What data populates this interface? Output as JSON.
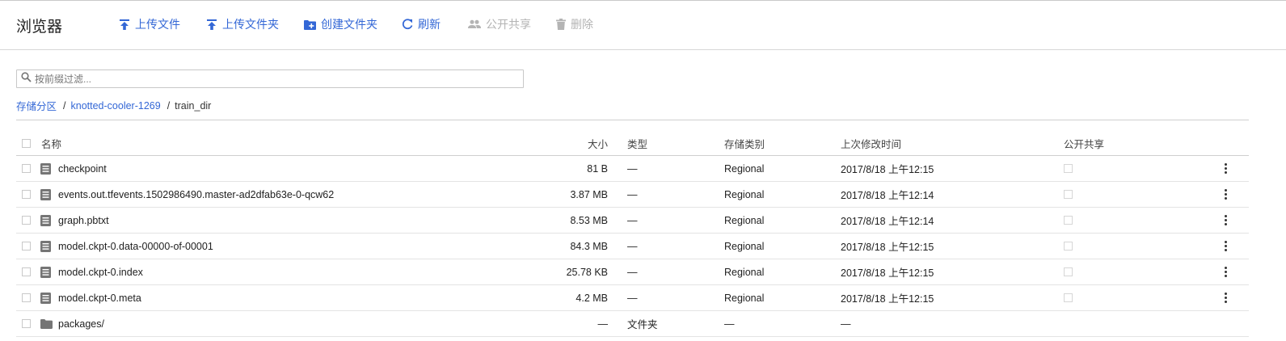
{
  "header": {
    "title": "浏览器",
    "toolbar": {
      "upload_files": "上传文件",
      "upload_folder": "上传文件夹",
      "create_folder": "创建文件夹",
      "refresh": "刷新",
      "share_publicly": "公开共享",
      "delete": "删除"
    }
  },
  "filter": {
    "placeholder": "按前缀过滤..."
  },
  "breadcrumb": {
    "root": "存储分区",
    "bucket": "knotted-cooler-1269",
    "current": "train_dir",
    "separator": "/"
  },
  "table": {
    "columns": {
      "name": "名称",
      "size": "大小",
      "type": "类型",
      "storage_class": "存储类别",
      "modified": "上次修改时间",
      "public": "公开共享"
    },
    "rows": [
      {
        "name": "checkpoint",
        "size": "81 B",
        "type": "—",
        "storage_class": "Regional",
        "modified": "2017/8/18 上午12:15",
        "kind": "file"
      },
      {
        "name": "events.out.tfevents.1502986490.master-ad2dfab63e-0-qcw62",
        "size": "3.87 MB",
        "type": "—",
        "storage_class": "Regional",
        "modified": "2017/8/18 上午12:14",
        "kind": "file"
      },
      {
        "name": "graph.pbtxt",
        "size": "8.53 MB",
        "type": "—",
        "storage_class": "Regional",
        "modified": "2017/8/18 上午12:14",
        "kind": "file"
      },
      {
        "name": "model.ckpt-0.data-00000-of-00001",
        "size": "84.3 MB",
        "type": "—",
        "storage_class": "Regional",
        "modified": "2017/8/18 上午12:15",
        "kind": "file"
      },
      {
        "name": "model.ckpt-0.index",
        "size": "25.78 KB",
        "type": "—",
        "storage_class": "Regional",
        "modified": "2017/8/18 上午12:15",
        "kind": "file"
      },
      {
        "name": "model.ckpt-0.meta",
        "size": "4.2 MB",
        "type": "—",
        "storage_class": "Regional",
        "modified": "2017/8/18 上午12:15",
        "kind": "file"
      },
      {
        "name": "packages/",
        "size": "—",
        "type": "文件夹",
        "storage_class": "—",
        "modified": "—",
        "kind": "folder"
      }
    ]
  },
  "colors": {
    "accent": "#3367d6",
    "disabled": "#b4b4b4",
    "icon_gray": "#757575"
  },
  "icons": {
    "upload_files": "upload-icon",
    "upload_folder": "upload-folder-icon",
    "create_folder": "create-folder-icon",
    "refresh": "refresh-icon",
    "share": "people-icon",
    "delete": "trash-icon",
    "file": "document-icon",
    "folder": "folder-icon",
    "row_menu": "more-vert-icon"
  }
}
